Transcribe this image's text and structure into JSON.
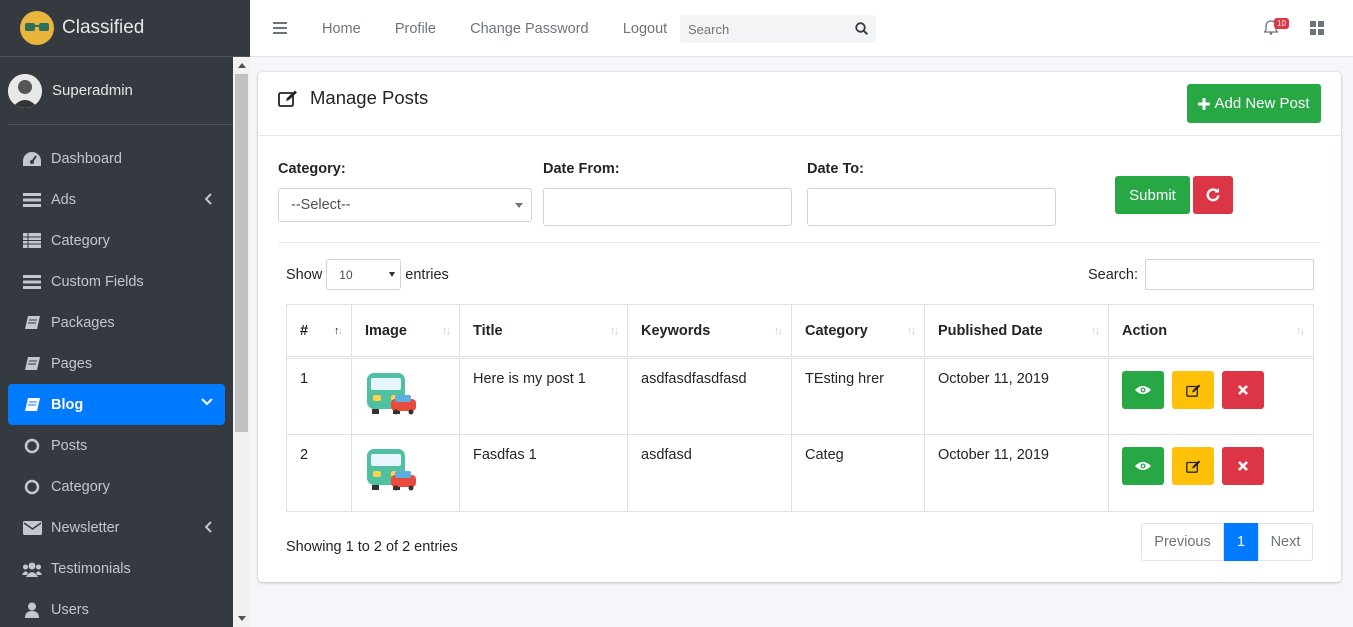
{
  "brand": {
    "name": "Classified"
  },
  "user": {
    "name": "Superadmin"
  },
  "sidebar": {
    "items": [
      {
        "label": "Dashboard"
      },
      {
        "label": "Ads"
      },
      {
        "label": "Category"
      },
      {
        "label": "Custom Fields"
      },
      {
        "label": "Packages"
      },
      {
        "label": "Pages"
      },
      {
        "label": "Blog"
      },
      {
        "label": "Posts"
      },
      {
        "label": "Category"
      },
      {
        "label": "Newsletter"
      },
      {
        "label": "Testimonials"
      },
      {
        "label": "Users"
      }
    ]
  },
  "topnav": {
    "home": "Home",
    "profile": "Profile",
    "change_password": "Change Password",
    "logout": "Logout",
    "search_placeholder": "Search",
    "notification_count": "10"
  },
  "page": {
    "title": "Manage Posts",
    "add_button": "Add New Post"
  },
  "filters": {
    "category_label": "Category:",
    "category_value": "--Select--",
    "date_from_label": "Date From:",
    "date_to_label": "Date To:",
    "submit": "Submit"
  },
  "table_controls": {
    "show": "Show",
    "page_length": "10",
    "entries": "entries",
    "search_label": "Search:"
  },
  "table": {
    "headers": [
      "#",
      "Image",
      "Title",
      "Keywords",
      "Category",
      "Published Date",
      "Action"
    ],
    "rows": [
      {
        "num": "1",
        "title": "Here is my post 1",
        "keywords": "asdfasdfasdfasd",
        "category": "TEsting hrer",
        "date": "October 11, 2019"
      },
      {
        "num": "2",
        "title": "Fasdfas 1",
        "keywords": "asdfasd",
        "category": "Categ",
        "date": "October 11, 2019"
      }
    ]
  },
  "footer": {
    "info": "Showing 1 to 2 of 2 entries",
    "previous": "Previous",
    "current_page": "1",
    "next": "Next"
  },
  "colors": {
    "sidebar": "#343a40",
    "active": "#007bff",
    "success": "#28a745",
    "warning": "#ffc107",
    "danger": "#dc3545"
  }
}
